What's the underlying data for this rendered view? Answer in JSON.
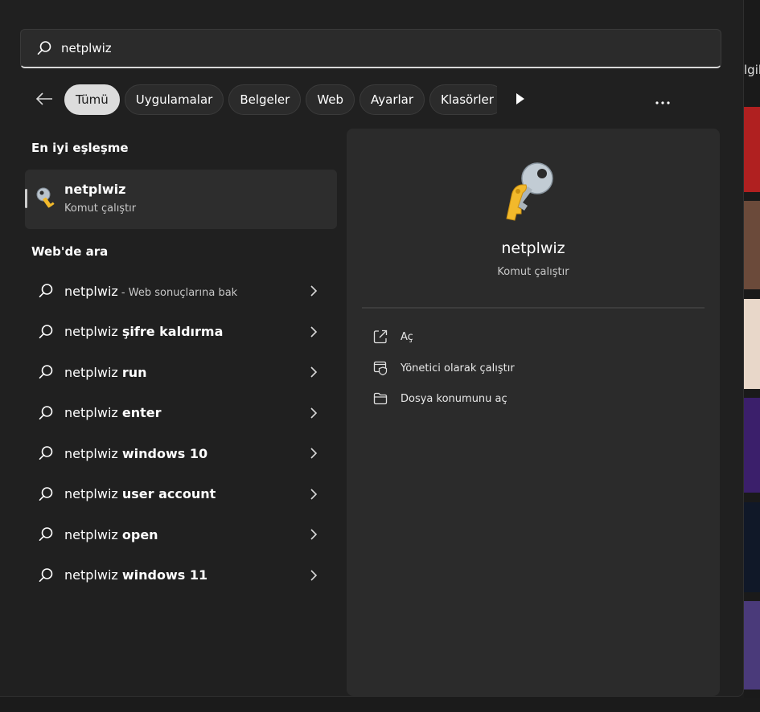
{
  "search": {
    "value": "netplwiz",
    "placeholder": ""
  },
  "filters": {
    "back_label": "",
    "chips": [
      "Tümü",
      "Uygulamalar",
      "Belgeler",
      "Web",
      "Ayarlar",
      "Klasörler"
    ],
    "active_index": 0
  },
  "best_match": {
    "heading": "En iyi eşleşme",
    "name": "netplwiz",
    "type": "Komut çalıştır"
  },
  "web_search": {
    "heading": "Web'de ara",
    "items": [
      {
        "query": "netplwiz",
        "suffix": "",
        "hint": " - Web sonuçlarına bak"
      },
      {
        "query": "netplwiz ",
        "suffix": "şifre kaldırma",
        "hint": ""
      },
      {
        "query": "netplwiz ",
        "suffix": "run",
        "hint": ""
      },
      {
        "query": "netplwiz ",
        "suffix": "enter",
        "hint": ""
      },
      {
        "query": "netplwiz ",
        "suffix": "windows 10",
        "hint": ""
      },
      {
        "query": "netplwiz ",
        "suffix": "user account",
        "hint": ""
      },
      {
        "query": "netplwiz ",
        "suffix": "open",
        "hint": ""
      },
      {
        "query": "netplwiz ",
        "suffix": "windows 11",
        "hint": ""
      }
    ]
  },
  "detail": {
    "title": "netplwiz",
    "subtitle": "Komut çalıştır",
    "actions": [
      {
        "label": "Aç",
        "icon": "open-external-icon"
      },
      {
        "label": "Yönetici olarak çalıştır",
        "icon": "admin-shield-icon"
      },
      {
        "label": "Dosya konumunu aç",
        "icon": "folder-icon"
      }
    ]
  },
  "background_peek": {
    "text": "lgil"
  },
  "colors": {
    "panel": "#202020",
    "card": "#2b2b2b",
    "active_chip": "#dcdcdc",
    "key_gold": "#f2b92b"
  }
}
